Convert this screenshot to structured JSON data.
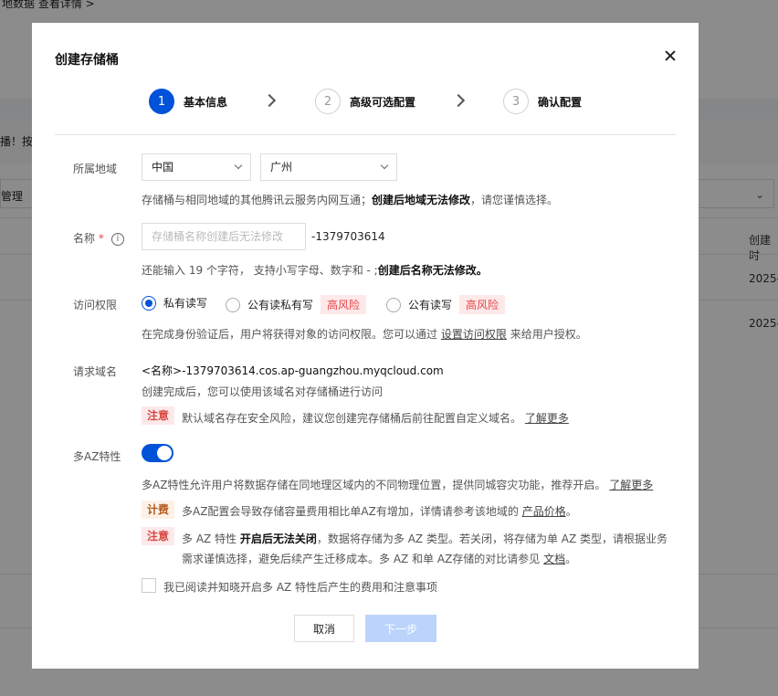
{
  "background": {
    "breadcrumb": "地数据   查看详情 >",
    "notice": "播！按",
    "manage": "管理",
    "header_col": "创建时",
    "row1_date": "2025-",
    "row2_date": "2025-"
  },
  "modal": {
    "title": "创建存储桶",
    "steps": [
      {
        "num": "1",
        "label": "基本信息"
      },
      {
        "num": "2",
        "label": "高级可选配置"
      },
      {
        "num": "3",
        "label": "确认配置"
      }
    ],
    "region": {
      "label": "所属地域",
      "country": "中国",
      "city": "广州",
      "hint_pre": "存储桶与相同地域的其他腾讯云服务内网互通；",
      "hint_bold": "创建后地域无法修改",
      "hint_post": "，请您谨慎选择。"
    },
    "name": {
      "label": "名称",
      "required": "*",
      "help": "i",
      "placeholder": "存储桶名称创建后无法修改",
      "value": "",
      "suffix": "-1379703614",
      "hint_pre": "还能输入 19 个字符， 支持小写字母、数字和 - ;",
      "hint_bold": "创建后名称无法修改。"
    },
    "access": {
      "label": "访问权限",
      "options": [
        {
          "label": "私有读写",
          "risk": ""
        },
        {
          "label": "公有读私有写",
          "risk": "高风险"
        },
        {
          "label": "公有读写",
          "risk": "高风险"
        }
      ],
      "selected": "私有读写",
      "hint_pre": "在完成身份验证后，用户将获得对象的访问权限。您可以通过",
      "hint_link": "设置访问权限",
      "hint_post": "来给用户授权。"
    },
    "domain": {
      "label": "请求域名",
      "value": "<名称>-1379703614.cos.ap-guangzhou.myqcloud.com",
      "hint": "创建完成后，您可以使用该域名对存储桶进行访问",
      "notice_tag": "注意",
      "notice_text": "默认域名存在安全风险，建议您创建完存储桶后前往配置自定义域名。",
      "notice_link": "了解更多"
    },
    "multi_az": {
      "label": "多AZ特性",
      "enabled": true,
      "desc": "多AZ特性允许用户将数据存储在同地理区域内的不同物理位置，提供同城容灾功能，推荐开启。",
      "desc_link": "了解更多",
      "fee_tag": "计费",
      "fee_text": "多AZ配置会导致存储容量费用相比单AZ有增加，详情请参考该地域的",
      "fee_link": "产品价格",
      "fee_post": "。",
      "warn_tag": "注意",
      "warn_pre": "多 AZ 特性",
      "warn_bold": "开启后无法关闭",
      "warn_line1_post": "，数据将存储为多 AZ 类型。若关闭，将存储为单 AZ 类型，请根据业务",
      "warn_line2": "需求谨慎选择，避免后续产生迁移成本。多 AZ 和单 AZ存储的对比请参见",
      "warn_link": "文档",
      "warn_post": "。"
    },
    "agree_label": "我已阅读并知晓开启多 AZ 特性后产生的费用和注意事项",
    "cancel_label": "取消",
    "next_label": "下一步"
  },
  "colors": {
    "primary": "#0052d9",
    "danger": "#e54545",
    "fee": "#b2591d",
    "disabled_btn": "#bcd4fb"
  }
}
